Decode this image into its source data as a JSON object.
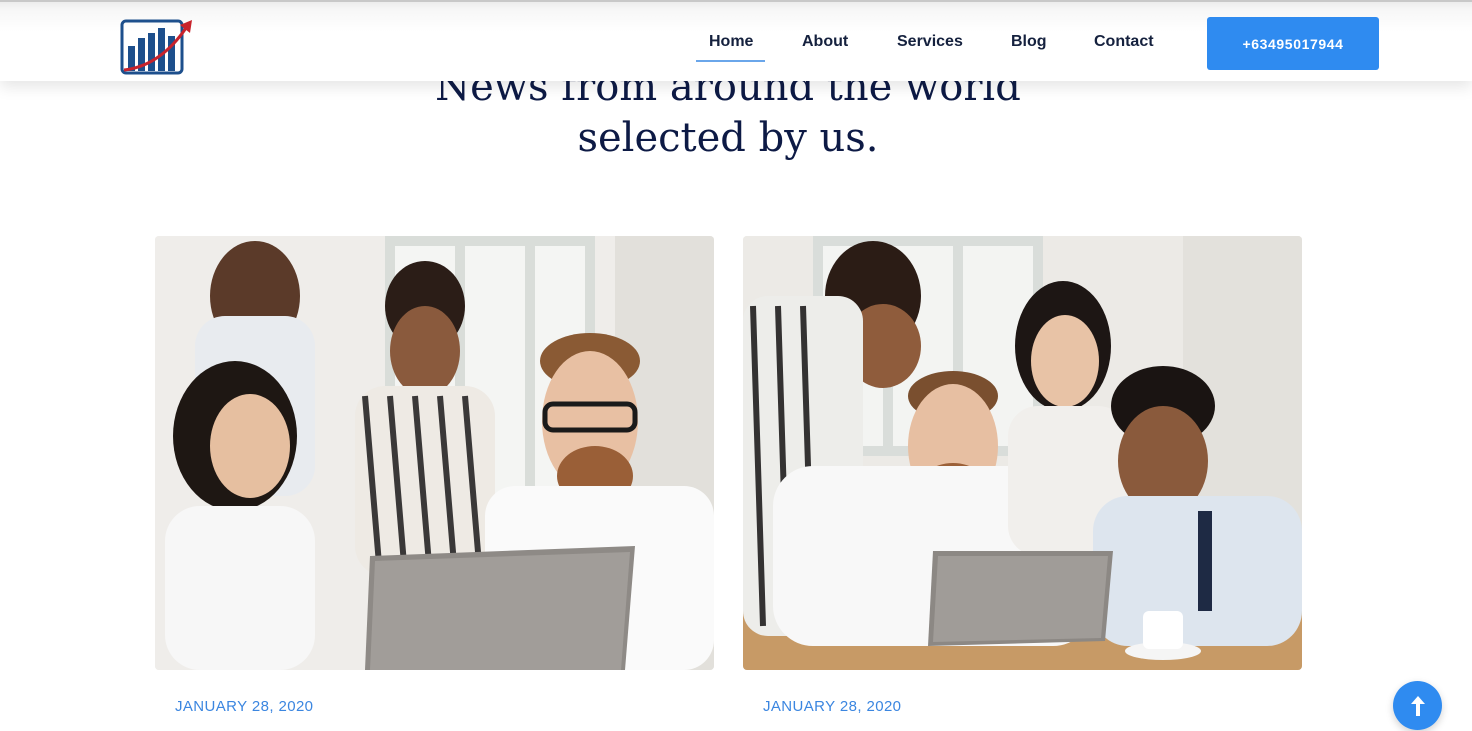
{
  "header": {
    "logo_name": "bar-chart-growth-logo",
    "nav": [
      {
        "label": "Home",
        "active": true
      },
      {
        "label": "About"
      },
      {
        "label": "Services"
      },
      {
        "label": "Blog"
      },
      {
        "label": "Contact"
      }
    ],
    "phone_button": "+63495017944"
  },
  "section": {
    "heading_line1": "News from around the world",
    "heading_line2": "selected by us."
  },
  "posts": [
    {
      "date": "JANUARY 28, 2020",
      "image": "excited-team-at-laptop-photo"
    },
    {
      "date": "JANUARY 28, 2020",
      "image": "smiling-team-at-laptop-photo"
    }
  ],
  "scroll_top_icon": "arrow-up-icon",
  "colors": {
    "accent": "#2f8bf0",
    "navy": "#0d1a45",
    "date_blue": "#3b86e0"
  }
}
